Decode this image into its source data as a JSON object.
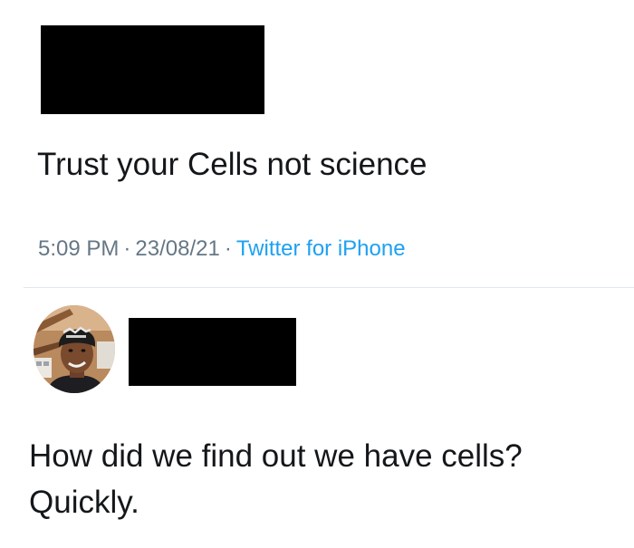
{
  "tweet": {
    "text": "Trust your Cells not science",
    "time": "5:09 PM",
    "separator": "·",
    "date": "23/08/21",
    "source": "Twitter for iPhone"
  },
  "reply": {
    "line1": "How did we find out we have cells?",
    "line2": "Quickly."
  },
  "colors": {
    "text": "#14171a",
    "meta": "#657786",
    "link": "#1da1f2",
    "divider": "#e1e8ed"
  }
}
